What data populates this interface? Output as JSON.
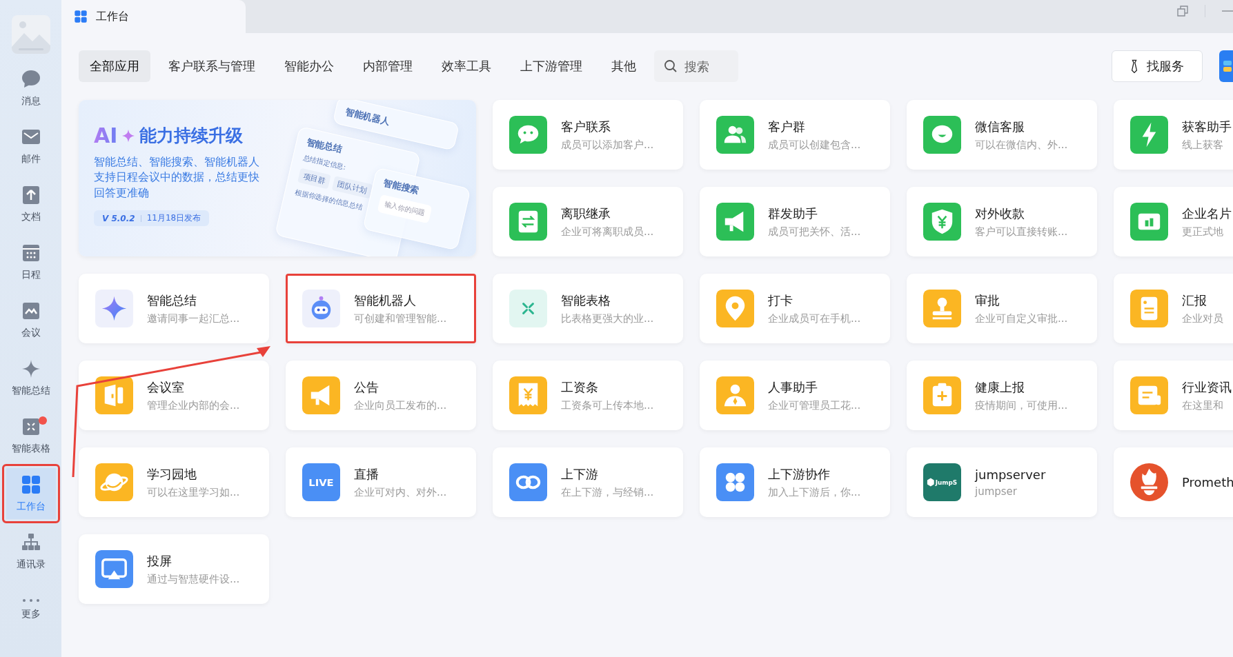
{
  "sidebar": {
    "items": [
      {
        "label": "消息",
        "kind": "bubble",
        "selected": false,
        "badge": false,
        "highlighted": false
      },
      {
        "label": "邮件",
        "kind": "envelope",
        "selected": false,
        "badge": false,
        "highlighted": false
      },
      {
        "label": "文档",
        "kind": "doc",
        "selected": false,
        "badge": false,
        "highlighted": false
      },
      {
        "label": "日程",
        "kind": "calendar",
        "selected": false,
        "badge": false,
        "highlighted": false
      },
      {
        "label": "会议",
        "kind": "meeting",
        "selected": false,
        "badge": false,
        "highlighted": false
      },
      {
        "label": "智能总结",
        "kind": "sparkle",
        "selected": false,
        "badge": false,
        "highlighted": false
      },
      {
        "label": "智能表格",
        "kind": "sheet",
        "selected": false,
        "badge": true,
        "highlighted": false
      },
      {
        "label": "工作台",
        "kind": "grid",
        "selected": true,
        "badge": false,
        "highlighted": true
      },
      {
        "label": "通讯录",
        "kind": "tree",
        "selected": false,
        "badge": false,
        "highlighted": false
      },
      {
        "label": "更多",
        "kind": "dots",
        "selected": false,
        "badge": false,
        "highlighted": false
      }
    ]
  },
  "window": {
    "title": "工作台"
  },
  "tabs": [
    {
      "label": "全部应用",
      "selected": true
    },
    {
      "label": "客户联系与管理",
      "selected": false
    },
    {
      "label": "智能办公",
      "selected": false
    },
    {
      "label": "内部管理",
      "selected": false
    },
    {
      "label": "效率工具",
      "selected": false
    },
    {
      "label": "上下游管理",
      "selected": false
    },
    {
      "label": "其他",
      "selected": false
    }
  ],
  "search": {
    "placeholder": "搜索"
  },
  "service_button": "找服务",
  "banner": {
    "brand": "AI",
    "title": "能力持续升级",
    "lines": [
      "智能总结、智能搜索、智能机器人",
      "支持日程会议中的数据，总结更快",
      "回答更准确"
    ],
    "version": "V 5.0.2",
    "date": "11月18日发布",
    "panels": {
      "robot": "智能机器人",
      "summary": "智能总结",
      "summary_hint": "总结指定信息:",
      "chips": [
        "项目群",
        "团队计划"
      ],
      "summary_text": "根据你选择的信息总结",
      "search": "智能搜索",
      "search_placeholder": "输入你的问题"
    }
  },
  "apps": [
    {
      "name": "客户联系",
      "desc": "成员可以添加客户...",
      "icon": {
        "kind": "chat",
        "color": "#2cbf57"
      },
      "highlighted": false
    },
    {
      "name": "客户群",
      "desc": "成员可以创建包含...",
      "icon": {
        "kind": "people",
        "color": "#2cbf57"
      },
      "highlighted": false
    },
    {
      "name": "微信客服",
      "desc": "可以在微信内、外...",
      "icon": {
        "kind": "smile",
        "color": "#2cbf57"
      },
      "highlighted": false
    },
    {
      "name": "获客助手",
      "desc": "线上获客",
      "icon": {
        "kind": "bolt",
        "color": "#2cbf57"
      },
      "highlighted": false
    },
    {
      "name": "离职继承",
      "desc": "企业可将离职成员...",
      "icon": {
        "kind": "swap",
        "color": "#2cbf57"
      },
      "highlighted": false
    },
    {
      "name": "群发助手",
      "desc": "成员可把关怀、活...",
      "icon": {
        "kind": "megaphone",
        "color": "#2cbf57"
      },
      "highlighted": false
    },
    {
      "name": "对外收款",
      "desc": "客户可以直接转账...",
      "icon": {
        "kind": "shield",
        "color": "#2cbf57"
      },
      "highlighted": false
    },
    {
      "name": "企业名片",
      "desc": "更正式地",
      "icon": {
        "kind": "card",
        "color": "#2cbf57"
      },
      "highlighted": false
    },
    {
      "name": "智能总结",
      "desc": "邀请同事一起汇总...",
      "icon": {
        "kind": "sparkle",
        "color": "#eef0fb"
      },
      "highlighted": false
    },
    {
      "name": "智能机器人",
      "desc": "可创建和管理智能...",
      "icon": {
        "kind": "robot",
        "color": "#eef0fb"
      },
      "highlighted": true
    },
    {
      "name": "智能表格",
      "desc": "比表格更强大的业...",
      "icon": {
        "kind": "table",
        "color": "#e2f6f1"
      },
      "highlighted": false
    },
    {
      "name": "打卡",
      "desc": "企业成员可在手机...",
      "icon": {
        "kind": "pin",
        "color": "#fbb623"
      },
      "highlighted": false
    },
    {
      "name": "审批",
      "desc": "企业可自定义审批...",
      "icon": {
        "kind": "stamp",
        "color": "#fbb623"
      },
      "highlighted": false
    },
    {
      "name": "汇报",
      "desc": "企业对员",
      "icon": {
        "kind": "document",
        "color": "#fbb623"
      },
      "highlighted": false
    },
    {
      "name": "会议室",
      "desc": "管理企业内部的会...",
      "icon": {
        "kind": "door",
        "color": "#fbb623"
      },
      "highlighted": false
    },
    {
      "name": "公告",
      "desc": "企业向员工发布的...",
      "icon": {
        "kind": "megaphone",
        "color": "#fbb623"
      },
      "highlighted": false
    },
    {
      "name": "工资条",
      "desc": "工资条可上传本地...",
      "icon": {
        "kind": "receipt",
        "color": "#fbb623"
      },
      "highlighted": false
    },
    {
      "name": "人事助手",
      "desc": "企业可管理员工花...",
      "icon": {
        "kind": "person",
        "color": "#fbb623"
      },
      "highlighted": false
    },
    {
      "name": "健康上报",
      "desc": "疫情期间，可使用...",
      "icon": {
        "kind": "clipboard",
        "color": "#fbb623"
      },
      "highlighted": false
    },
    {
      "name": "行业资讯",
      "desc": "在这里和",
      "icon": {
        "kind": "news",
        "color": "#fbb623"
      },
      "highlighted": false
    },
    {
      "name": "学习园地",
      "desc": "可以在这里学习如...",
      "icon": {
        "kind": "planet",
        "color": "#fbb623"
      },
      "highlighted": false
    },
    {
      "name": "直播",
      "desc": "企业可对内、对外...",
      "icon": {
        "kind": "live",
        "color": "#4a8ff5",
        "text": "LIVE"
      },
      "highlighted": false
    },
    {
      "name": "上下游",
      "desc": "在上下游，与经销...",
      "icon": {
        "kind": "link",
        "color": "#4a8ff5"
      },
      "highlighted": false
    },
    {
      "name": "上下游协作",
      "desc": "加入上下游后，你...",
      "icon": {
        "kind": "clover",
        "color": "#4a8ff5"
      },
      "highlighted": false
    },
    {
      "name": "jumpserver",
      "desc": "jumpser",
      "icon": {
        "kind": "logo",
        "color": "#1f7a6a",
        "text": "JumpS"
      },
      "highlighted": false
    },
    {
      "name": "Prometh",
      "icon": {
        "kind": "flame",
        "color": "#e5522c"
      },
      "highlighted": false
    },
    {
      "name": "投屏",
      "desc": "通过与智慧硬件设...",
      "icon": {
        "kind": "screen",
        "color": "#4a8ff5"
      },
      "highlighted": false
    }
  ]
}
